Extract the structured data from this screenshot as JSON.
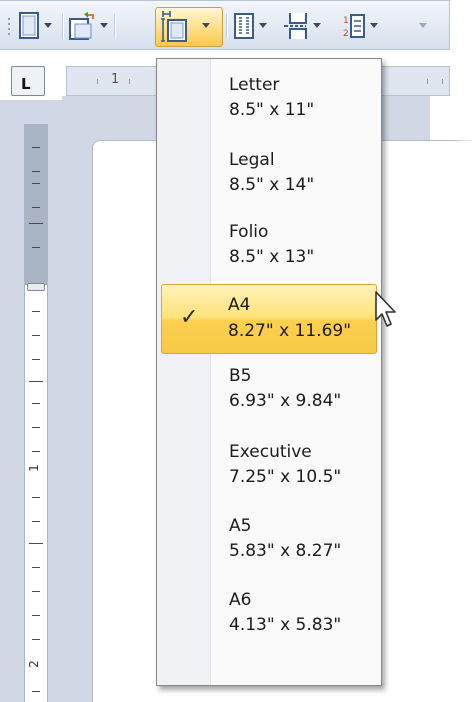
{
  "toolbar": {
    "buttons": [
      {
        "name": "page-orientation",
        "icon": "page-orientation-icon"
      },
      {
        "name": "page-margins",
        "icon": "page-margins-icon"
      },
      {
        "name": "page-size",
        "icon": "page-size-icon",
        "active": true
      },
      {
        "name": "columns",
        "icon": "columns-icon"
      },
      {
        "name": "breaks",
        "icon": "breaks-icon"
      },
      {
        "name": "line-numbers",
        "icon": "line-numbers-icon"
      }
    ],
    "overflow_icon": "toolbar-overflow-icon"
  },
  "ruler": {
    "corner_label": "L",
    "horizontal_label": "1",
    "vertical_labels": [
      "1",
      "2"
    ]
  },
  "menu": {
    "items": [
      {
        "name": "Letter",
        "size": "8.5\" x 11\"",
        "selected": false
      },
      {
        "name": "Legal",
        "size": "8.5\" x 14\"",
        "selected": false
      },
      {
        "name": "Folio",
        "size": "8.5\" x 13\"",
        "selected": false
      },
      {
        "name": "A4",
        "size": "8.27\" x 11.69\"",
        "selected": true
      },
      {
        "name": "B5",
        "size": "6.93\" x 9.84\"",
        "selected": false
      },
      {
        "name": "Executive",
        "size": "7.25\" x 10.5\"",
        "selected": false
      },
      {
        "name": "A5",
        "size": "5.83\" x 8.27\"",
        "selected": false
      },
      {
        "name": "A6",
        "size": "4.13\" x 5.83\"",
        "selected": false
      }
    ],
    "check_mark": "✓"
  },
  "colors": {
    "highlight_top": "#fff3b8",
    "highlight_bottom": "#f7c947",
    "highlight_border": "#d9a43a",
    "toolbar_bg": "#e3eaf3",
    "workspace_bg": "#cfd8e4"
  }
}
